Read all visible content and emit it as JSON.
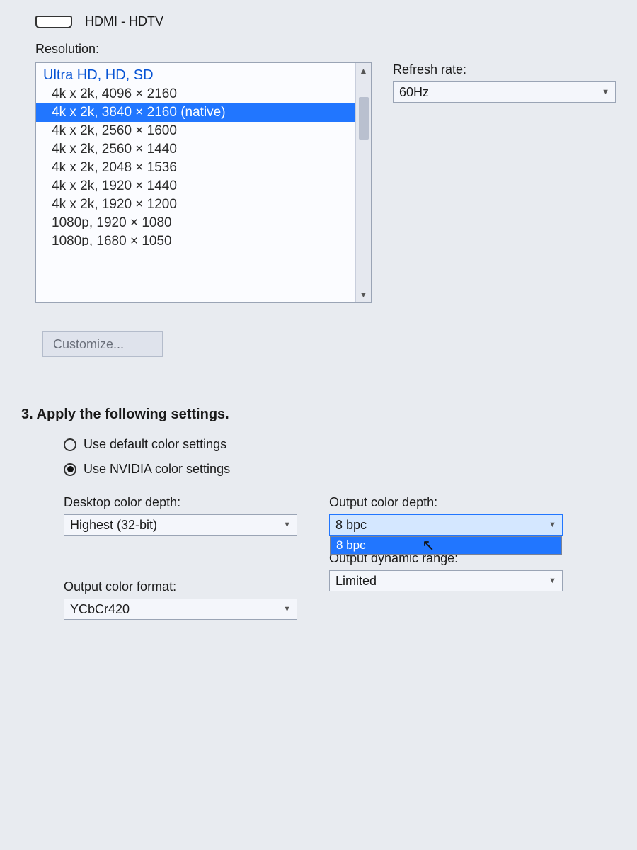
{
  "connector": {
    "label": "HDMI - HDTV"
  },
  "resolution": {
    "label": "Resolution:",
    "group_header": "Ultra HD, HD, SD",
    "items": [
      {
        "text": "4k x 2k, 4096 × 2160",
        "selected": false
      },
      {
        "text": "4k x 2k, 3840 × 2160 (native)",
        "selected": true
      },
      {
        "text": "4k x 2k, 2560 × 1600",
        "selected": false
      },
      {
        "text": "4k x 2k, 2560 × 1440",
        "selected": false
      },
      {
        "text": "4k x 2k, 2048 × 1536",
        "selected": false
      },
      {
        "text": "4k x 2k, 1920 × 1440",
        "selected": false
      },
      {
        "text": "4k x 2k, 1920 × 1200",
        "selected": false
      },
      {
        "text": "1080p, 1920 × 1080",
        "selected": false
      },
      {
        "text": "1080p, 1680 × 1050",
        "selected": false
      }
    ]
  },
  "refresh_rate": {
    "label": "Refresh rate:",
    "value": "60Hz"
  },
  "customize_label": "Customize...",
  "section3_heading": "3. Apply the following settings.",
  "color_mode": {
    "option_default": "Use default color settings",
    "option_nvidia": "Use NVIDIA color settings",
    "selected": "nvidia"
  },
  "desktop_color_depth": {
    "label": "Desktop color depth:",
    "value": "Highest (32-bit)"
  },
  "output_color_depth": {
    "label": "Output color depth:",
    "value": "8 bpc",
    "options": [
      "8 bpc"
    ]
  },
  "output_color_format": {
    "label": "Output color format:",
    "value": "YCbCr420"
  },
  "output_dynamic_range": {
    "label": "Output dynamic range:",
    "value": "Limited"
  }
}
